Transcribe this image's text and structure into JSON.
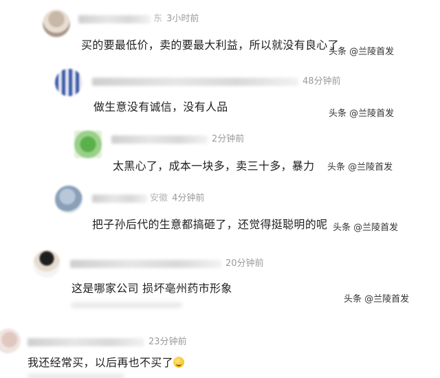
{
  "comments": [
    {
      "location": "东",
      "time": "3小时前",
      "text": "买的要最低价，卖的要最大利益，所以就没有良心了",
      "watermark": "头条 @兰陵首发"
    },
    {
      "location": "",
      "time": "48分钟前",
      "text": "做生意没有诚信，没有人品",
      "watermark": "头条 @兰陵首发"
    },
    {
      "location": "",
      "time": "2分钟前",
      "text": "太黑心了，成本一块多，卖三十多，暴力",
      "watermark": "头条 @兰陵首发"
    },
    {
      "location": "安徽",
      "time": "4分钟前",
      "text": "把子孙后代的生意都搞砸了，还觉得挺聪明的呢",
      "watermark": "头条 @兰陵首发"
    },
    {
      "location": "",
      "time": "20分钟前",
      "text": "这是哪家公司 损坏亳州药市形象",
      "watermark": "头条 @兰陵首发"
    },
    {
      "location": "",
      "time": "23分钟前",
      "text": "我还经常买，以后再也不买了",
      "watermark": ""
    }
  ]
}
